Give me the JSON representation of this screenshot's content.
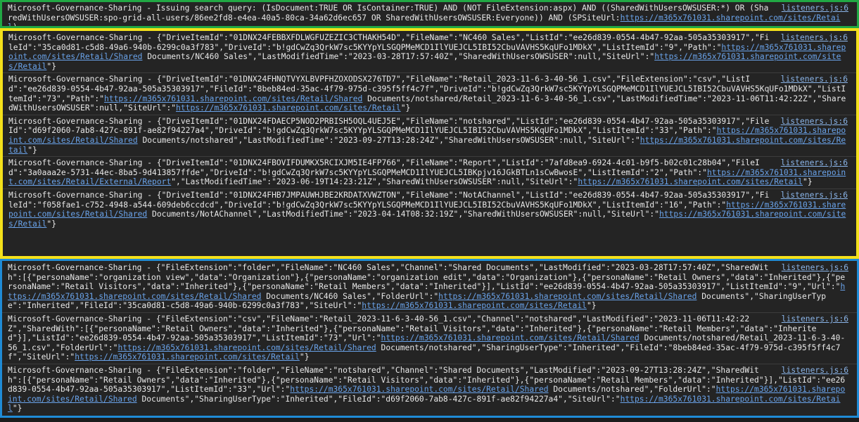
{
  "colors": {
    "green": "#21a844",
    "yellow": "#f4e01a",
    "blue": "#1f8bd6",
    "link": "#6aa3ea"
  },
  "query": {
    "source": "listeners.js:6",
    "text": "Microsoft-Governance-Sharing - Issuing search query: (IsDocument:TRUE OR IsContainer:TRUE) AND (NOT FileExtension:aspx) AND ((SharedWithUsersOWSUSER:*) OR (SharedWithUsersOWSUSER:spo-grid-all-users/86ee2fd8-e4ea-40a5-80ca-34a62d6ec657 OR SharedWithUsersOWSUSER:Everyone)) AND (SPSiteUrl:",
    "url": "https://m365x761031.sharepoint.com/sites/Retail",
    "suffix": ")"
  },
  "items": [
    {
      "source": "listeners.js:6",
      "t1": "Microsoft-Governance-Sharing - {\"DriveItemId\":\"01DNX24FEBBXFDLWGFUZEZIC3CTHAKH54D\",\"FileName\":\"NC460 Sales\",\"ListId\":\"ee26d839-0554-4b47-92aa-505a35303917\",\"FileId\":\"35ca0d81-c5d8-49a6-940b-6299c0a3f783\",\"DriveId\":\"b!gdCwZq3QrkW7sc5KYYpYLSGQPMeMCD1IlYUEJCL5IBI52CbuVAVHS5KqUFo1MDkX\",\"ListItemId\":\"9\",\"Path\":\"",
      "u1": "https://m365x761031.sharepoint.com/sites/Retail/Shared",
      "t2": " Documents/NC460 Sales\",\"LastModifiedTime\":\"2023-03-28T17:57:40Z\",\"SharedWithUsersOWSUSER\":null,\"SiteUrl\":\"",
      "u2": "https://m365x761031.sharepoint.com/sites/Retail",
      "t3": "\"}"
    },
    {
      "source": "listeners.js:6",
      "t1": "Microsoft-Governance-Sharing - {\"DriveItemId\":\"01DNX24FHNQTVYXLBVPFHZOXODSX276TD7\",\"FileName\":\"Retail_2023-11-6-3-40-56_1.csv\",\"FileExtension\":\"csv\",\"ListId\":\"ee26d839-0554-4b47-92aa-505a35303917\",\"FileId\":\"8beb84ed-35ac-4f79-975d-c395f5ff4c7f\",\"DriveId\":\"b!gdCwZq3QrkW7sc5KYYpYLSGQPMeMCD1IlYUEJCL5IBI52CbuVAVHS5KqUFo1MDkX\",\"ListItemId\":\"73\",\"Path\":\"",
      "u1": "https://m365x761031.sharepoint.com/sites/Retail/Shared",
      "t2": " Documents/notshared/Retail_2023-11-6-3-40-56_1.csv\",\"LastModifiedTime\":\"2023-11-06T11:42:22Z\",\"SharedWithUsersOWSUSER\":null,\"SiteUrl\":\"",
      "u2": "https://m365x761031.sharepoint.com/sites/Retail",
      "t3": "\"}"
    },
    {
      "source": "listeners.js:6",
      "t1": "Microsoft-Governance-Sharing - {\"DriveItemId\":\"01DNX24FDAECP5NOD2PRBISH5OQL4UEJ5E\",\"FileName\":\"notshared\",\"ListId\":\"ee26d839-0554-4b47-92aa-505a35303917\",\"FileId\":\"d69f2060-7ab8-427c-891f-ae82f94227a4\",\"DriveId\":\"b!gdCwZq3QrkW7sc5KYYpYLSGQPMeMCD1IlYUEJCL5IBI52CbuVAVHS5KqUFo1MDkX\",\"ListItemId\":\"33\",\"Path\":\"",
      "u1": "https://m365x761031.sharepoint.com/sites/Retail/Shared",
      "t2": " Documents/notshared\",\"LastModifiedTime\":\"2023-09-27T13:28:24Z\",\"SharedWithUsersOWSUSER\":null,\"SiteUrl\":\"",
      "u2": "https://m365x761031.sharepoint.com/sites/Retail",
      "t3": "\"}"
    },
    {
      "source": "listeners.js:6",
      "t1": "Microsoft-Governance-Sharing - {\"DriveItemId\":\"01DNX24FBOVIFDUMKX5RCIXJM5IE4FP766\",\"FileName\":\"Report\",\"ListId\":\"7afd8ea9-6924-4c01-b9f5-b02c01c28b04\",\"FileId\":\"3a0aaa2e-5731-44ec-8ba5-9d413857ffde\",\"DriveId\":\"b!gdCwZq3QrkW7sc5KYYpYLSGQPMeMCD1IlYUEJCL5IBKpjv16JGkBTLn1sCwBwosE\",\"ListItemId\":\"2\",\"Path\":\"",
      "u1": "https://m365x761031.sharepoint.com/sites/Retail/External/Report",
      "t2": "\",\"LastModifiedTime\":\"2023-06-19T14:23:21Z\",\"SharedWithUsersOWSUSER\":null,\"SiteUrl\":\"",
      "u2": "https://m365x761031.sharepoint.com/sites/Retail",
      "t3": "\"}"
    },
    {
      "source": "listeners.js:6",
      "t1": "Microsoft-Governance-Sharing - {\"DriveItemId\":\"01DNX24FHB7JMPAUWHJBE2KRDATXVWZTON\",\"FileName\":\"NotAChannel\",\"ListId\":\"ee26d839-0554-4b47-92aa-505a35303917\",\"FileId\":\"f058fae1-c752-4948-a544-609deb6ccdcd\",\"DriveId\":\"b!gdCwZq3QrkW7sc5KYYpYLSGQPMeMCD1IlYUEJCL5IBI52CbuVAVHS5KqUFo1MDkX\",\"ListItemId\":\"16\",\"Path\":\"",
      "u1": "https://m365x761031.sharepoint.com/sites/Retail/Shared",
      "t2": " Documents/NotAChannel\",\"LastModifiedTime\":\"2023-04-14T08:32:19Z\",\"SharedWithUsersOWSUSER\":null,\"SiteUrl\":\"",
      "u2": "https://m365x761031.sharepoint.com/sites/Retail",
      "t3": "\"}"
    }
  ],
  "shares": [
    {
      "source": "listeners.js:6",
      "t1": "Microsoft-Governance-Sharing - {\"FileExtension\":\"folder\",\"FileName\":\"NC460 Sales\",\"Channel\":\"Shared Documents\",\"LastModified\":\"2023-03-28T17:57:40Z\",\"SharedWith\":[{\"personaName\":\"organization view\",\"data\":\"Organization\"},{\"personaName\":\"organization edit\",\"data\":\"Organization\"},{\"personaName\":\"Retail Owners\",\"data\":\"Inherited\"},{\"personaName\":\"Retail Visitors\",\"data\":\"Inherited\"},{\"personaName\":\"Retail Members\",\"data\":\"Inherited\"}],\"ListId\":\"ee26d839-0554-4b47-92aa-505a35303917\",\"ListItemId\":\"9\",\"Url\":\"",
      "u1": "https://m365x761031.sharepoint.com/sites/Retail/Shared",
      "t2": " Documents/NC460 Sales\",\"FolderUrl\":\"",
      "u2": "https://m365x761031.sharepoint.com/sites/Retail/Shared",
      "t3": " Documents\",\"SharingUserType\":\"Inherited\",\"FileId\":\"35ca0d81-c5d8-49a6-940b-6299c0a3f783\",\"SiteUrl\":\"",
      "u3": "https://m365x761031.sharepoint.com/sites/Retail",
      "t4": "\"}"
    },
    {
      "source": "listeners.js:6",
      "t1": "Microsoft-Governance-Sharing - {\"FileExtension\":\"csv\",\"FileName\":\"Retail_2023-11-6-3-40-56_1.csv\",\"Channel\":\"notshared\",\"LastModified\":\"2023-11-06T11:42:22Z\",\"SharedWith\":[{\"personaName\":\"Retail Owners\",\"data\":\"Inherited\"},{\"personaName\":\"Retail Visitors\",\"data\":\"Inherited\"},{\"personaName\":\"Retail Members\",\"data\":\"Inherited\"}],\"ListId\":\"ee26d839-0554-4b47-92aa-505a35303917\",\"ListItemId\":\"73\",\"Url\":\"",
      "u1": "https://m365x761031.sharepoint.com/sites/Retail/Shared",
      "t2": " Documents/notshared/Retail_2023-11-6-3-40-56_1.csv\",\"FolderUrl\":\"",
      "u2": "https://m365x761031.sharepoint.com/sites/Retail/Shared",
      "t3": " Documents/notshared\",\"SharingUserType\":\"Inherited\",\"FileId\":\"8beb84ed-35ac-4f79-975d-c395f5ff4c7f\",\"SiteUrl\":\"",
      "u3": "https://m365x761031.sharepoint.com/sites/Retail",
      "t4": "\"}"
    },
    {
      "source": "listeners.js:6",
      "t1": "Microsoft-Governance-Sharing - {\"FileExtension\":\"folder\",\"FileName\":\"notshared\",\"Channel\":\"Shared Documents\",\"LastModified\":\"2023-09-27T13:28:24Z\",\"SharedWith\":[{\"personaName\":\"Retail Owners\",\"data\":\"Inherited\"},{\"personaName\":\"Retail Visitors\",\"data\":\"Inherited\"},{\"personaName\":\"Retail Members\",\"data\":\"Inherited\"}],\"ListId\":\"ee26d839-0554-4b47-92aa-505a35303917\",\"ListItemId\":\"33\",\"Url\":\"",
      "u1": "https://m365x761031.sharepoint.com/sites/Retail/Shared",
      "t2": " Documents/notshared\",\"FolderUrl\":\"",
      "u2": "https://m365x761031.sharepoint.com/sites/Retail/Shared",
      "t3": " Documents\",\"SharingUserType\":\"Inherited\",\"FileId\":\"d69f2060-7ab8-427c-891f-ae82f94227a4\",\"SiteUrl\":\"",
      "u3": "https://m365x761031.sharepoint.com/sites/Retail",
      "t4": "\"}"
    }
  ]
}
